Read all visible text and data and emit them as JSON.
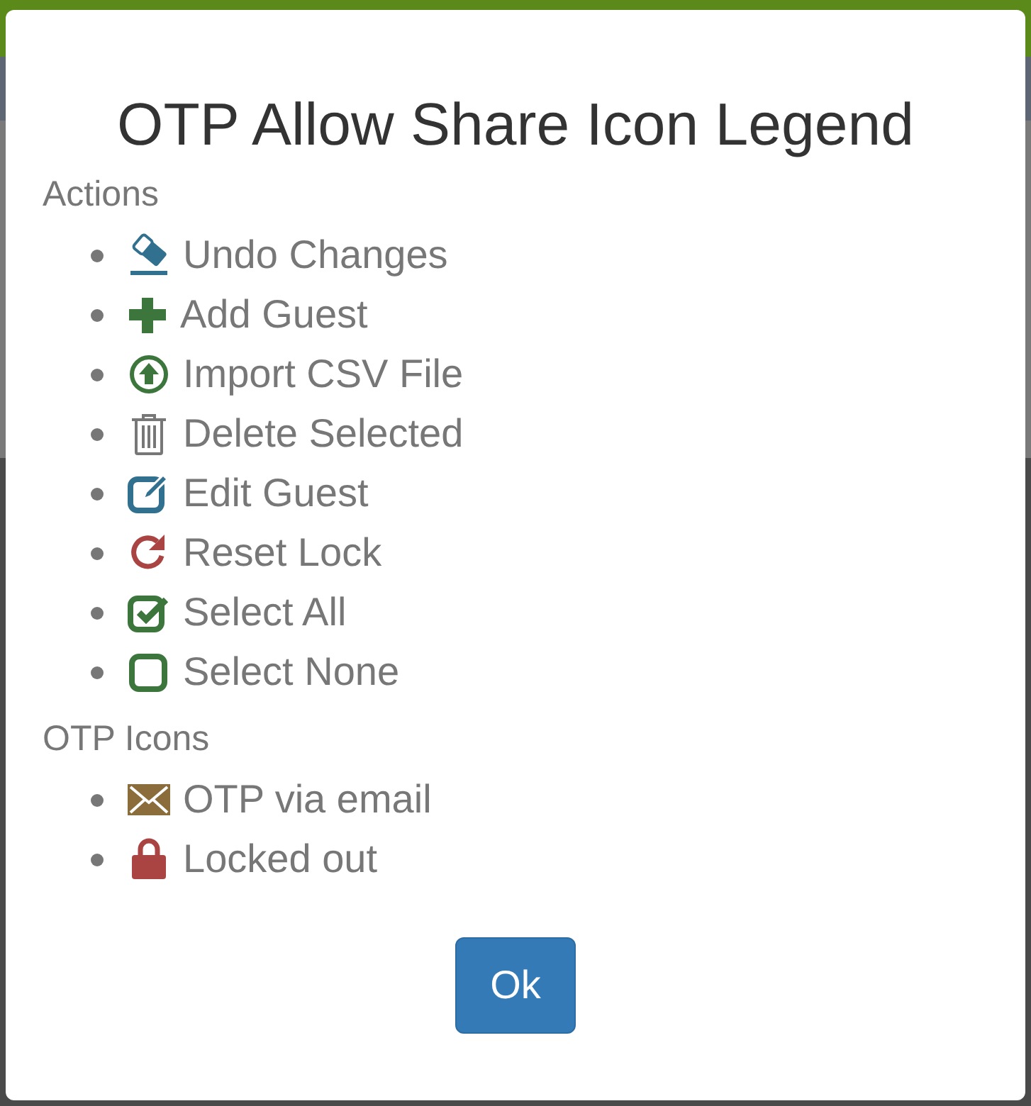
{
  "dialog": {
    "title": "OTP Allow Share Icon Legend",
    "sections": [
      {
        "heading": "Actions",
        "items": [
          {
            "kind": "eraser",
            "label": "Undo Changes"
          },
          {
            "kind": "plus",
            "label": "Add Guest"
          },
          {
            "kind": "upload",
            "label": "Import CSV File"
          },
          {
            "kind": "trash",
            "label": "Delete Selected"
          },
          {
            "kind": "edit",
            "label": "Edit Guest"
          },
          {
            "kind": "refresh",
            "label": "Reset Lock"
          },
          {
            "kind": "checkbox",
            "label": "Select All"
          },
          {
            "kind": "square",
            "label": "Select None"
          }
        ]
      },
      {
        "heading": "OTP Icons",
        "items": [
          {
            "kind": "envelope",
            "label": "OTP via email"
          },
          {
            "kind": "lock",
            "label": "Locked out"
          }
        ]
      }
    ],
    "button": "Ok"
  }
}
